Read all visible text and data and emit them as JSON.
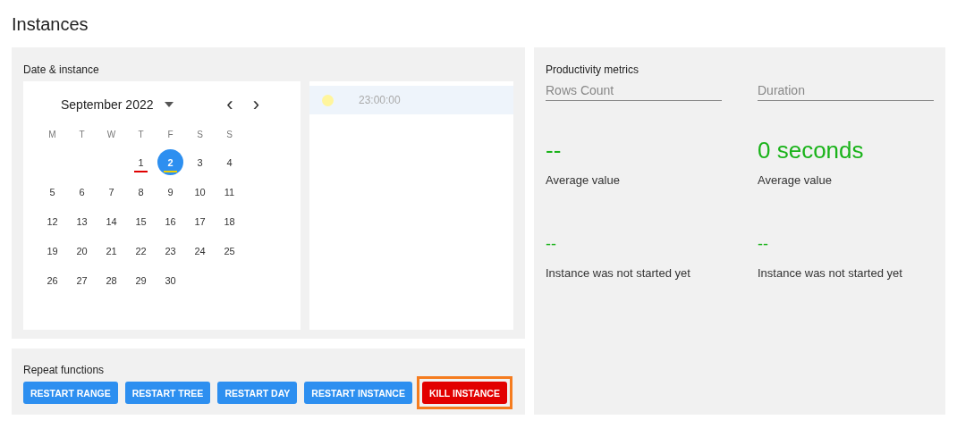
{
  "page_title": "Instances",
  "date_panel": {
    "title": "Date & instance",
    "calendar": {
      "month": "September 2022",
      "prev": "‹",
      "next": "›",
      "weekdays": [
        "M",
        "T",
        "W",
        "T",
        "F",
        "S",
        "S"
      ],
      "weeks": [
        {
          "kind": "first",
          "days": [
            {
              "label": "1",
              "selected": false,
              "color": "#e00000"
            },
            {
              "label": "2",
              "selected": true,
              "color": "#f0d000"
            },
            {
              "label": "3",
              "selected": false
            },
            {
              "label": "4",
              "selected": false
            }
          ]
        },
        {
          "kind": "full",
          "days": [
            {
              "label": "5",
              "selected": false
            },
            {
              "label": "6",
              "selected": false
            },
            {
              "label": "7",
              "selected": false
            },
            {
              "label": "8",
              "selected": false
            },
            {
              "label": "9",
              "selected": false
            },
            {
              "label": "10",
              "selected": false
            },
            {
              "label": "11",
              "selected": false
            }
          ]
        },
        {
          "kind": "full",
          "days": [
            {
              "label": "12",
              "selected": false
            },
            {
              "label": "13",
              "selected": false
            },
            {
              "label": "14",
              "selected": false
            },
            {
              "label": "15",
              "selected": false
            },
            {
              "label": "16",
              "selected": false
            },
            {
              "label": "17",
              "selected": false
            },
            {
              "label": "18",
              "selected": false
            }
          ]
        },
        {
          "kind": "full",
          "days": [
            {
              "label": "19",
              "selected": false
            },
            {
              "label": "20",
              "selected": false
            },
            {
              "label": "21",
              "selected": false
            },
            {
              "label": "22",
              "selected": false
            },
            {
              "label": "23",
              "selected": false
            },
            {
              "label": "24",
              "selected": false
            },
            {
              "label": "25",
              "selected": false
            }
          ]
        },
        {
          "kind": "last",
          "days": [
            {
              "label": "26",
              "selected": false
            },
            {
              "label": "27",
              "selected": false
            },
            {
              "label": "28",
              "selected": false
            },
            {
              "label": "29",
              "selected": false
            },
            {
              "label": "30",
              "selected": false
            }
          ]
        }
      ]
    },
    "instances": [
      {
        "time": "23:00:00",
        "color": "#fff59d",
        "selected": true
      }
    ]
  },
  "repeat_panel": {
    "title": "Repeat functions",
    "buttons": [
      {
        "label": "RESTART RANGE",
        "kind": "primary",
        "highlighted": false
      },
      {
        "label": "RESTART TREE",
        "kind": "primary",
        "highlighted": false
      },
      {
        "label": "RESTART DAY",
        "kind": "primary",
        "highlighted": false
      },
      {
        "label": "RESTART INSTANCE",
        "kind": "primary",
        "highlighted": false
      },
      {
        "label": "KILL INSTANCE",
        "kind": "danger",
        "highlighted": true
      }
    ]
  },
  "metrics_panel": {
    "title": "Productivity metrics",
    "columns": [
      {
        "placeholder": "Rows Count",
        "average": "--",
        "average_label": "Average value",
        "current": "--",
        "status": "Instance was not started yet"
      },
      {
        "placeholder": "Duration",
        "average": "0 seconds",
        "average_label": "Average value",
        "current": "--",
        "status": "Instance was not started yet"
      }
    ]
  }
}
